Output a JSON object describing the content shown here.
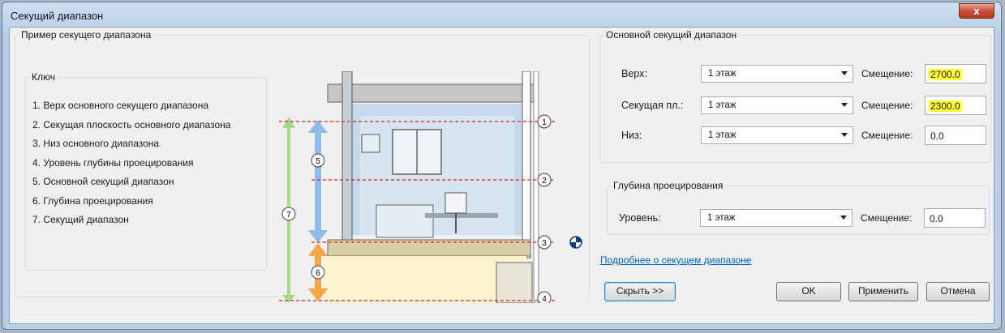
{
  "window": {
    "title": "Секущий диапазон",
    "close_glyph": "x"
  },
  "example": {
    "legend": "Пример секущего диапазона",
    "key": {
      "legend": "Ключ",
      "items": [
        "1. Верх основного секущего диапазона",
        "2. Секущая плоскость основного диапазона",
        "3. Низ основного диапазона",
        "4. Уровень глубины проецирования",
        "5. Основной секущий диапазон",
        "6. Глубина проецирования",
        "7. Секущий диапазон"
      ]
    },
    "markers": [
      "1",
      "2",
      "3",
      "4",
      "5",
      "6",
      "7"
    ]
  },
  "primary_range": {
    "legend": "Основной секущий диапазон",
    "rows": [
      {
        "label": "Верх:",
        "level": "1 этаж",
        "offset_label": "Смещение:",
        "offset": "2700.0"
      },
      {
        "label": "Секущая пл.:",
        "level": "1 этаж",
        "offset_label": "Смещение:",
        "offset": "2300.0"
      },
      {
        "label": "Низ:",
        "level": "1 этаж",
        "offset_label": "Смещение:",
        "offset": "0.0"
      }
    ]
  },
  "view_depth": {
    "legend": "Глубина проецирования",
    "label": "Уровень:",
    "level": "1 этаж",
    "offset_label": "Смещение:",
    "offset": "0.0"
  },
  "link_text": "Подробнее о секущем диапазоне",
  "buttons": {
    "hide": "Скрыть >>",
    "ok": "OK",
    "apply": "Применить",
    "cancel": "Отмена"
  },
  "colors": {
    "highlight": "#ffff33",
    "cut_line": "#e0201b",
    "primary_arrow": "#8dbde8",
    "depth_arrow": "#f5a54a",
    "range_arrow": "#a6d98a"
  }
}
